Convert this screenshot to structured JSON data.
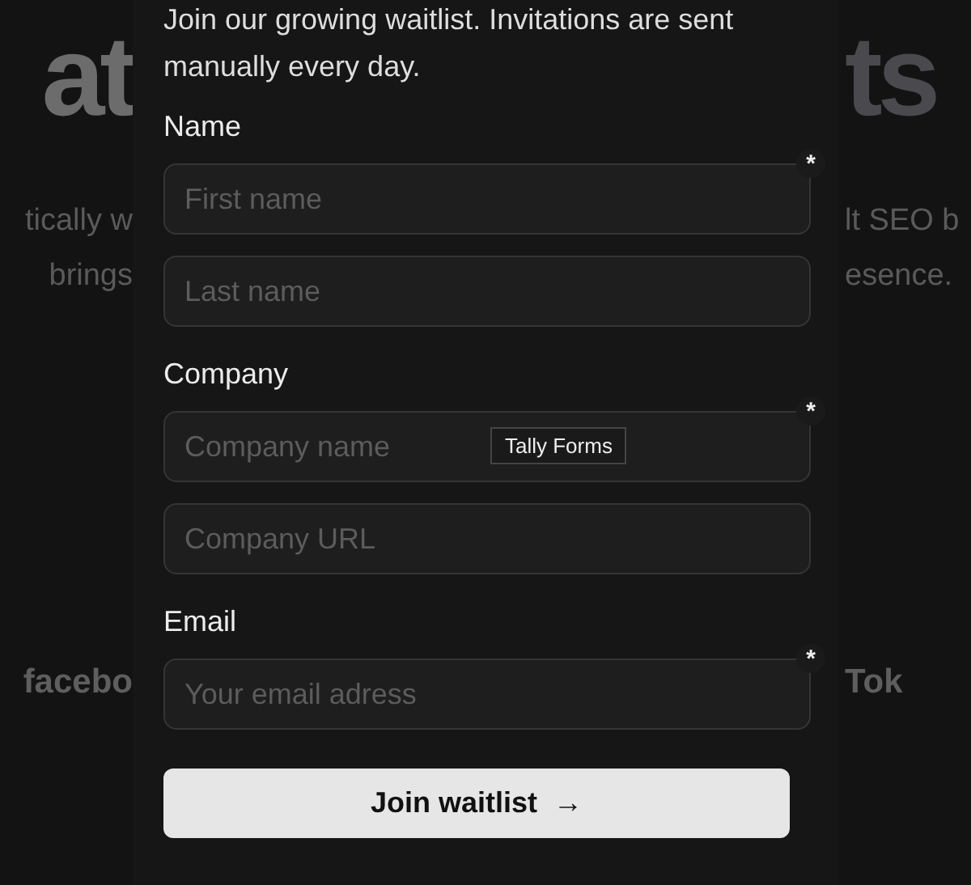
{
  "background": {
    "left": {
      "headline": "at",
      "lines": [
        "tically w",
        "brings"
      ],
      "logo": "facebo"
    },
    "right": {
      "headline": "ts",
      "lines": [
        "lt SEO b",
        "esence."
      ],
      "logo": "Tok"
    }
  },
  "form": {
    "intro": "Join our growing waitlist. Invitations are sent manually every day.",
    "groups": [
      {
        "label": "Name",
        "fields": [
          {
            "placeholder": "First name",
            "required": true
          },
          {
            "placeholder": "Last name",
            "required": false
          }
        ]
      },
      {
        "label": "Company",
        "fields": [
          {
            "placeholder": "Company name",
            "required": true,
            "tooltip": "Tally Forms"
          },
          {
            "placeholder": "Company URL",
            "required": false
          }
        ]
      },
      {
        "label": "Email",
        "fields": [
          {
            "placeholder": "Your email adress",
            "required": true
          }
        ]
      }
    ],
    "submit": {
      "label": "Join waitlist",
      "icon": "→"
    },
    "required_mark": "*"
  }
}
